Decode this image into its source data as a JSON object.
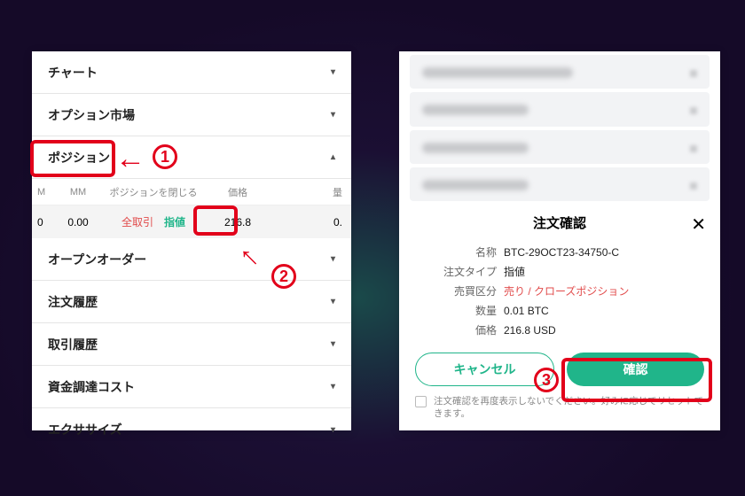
{
  "left": {
    "chart": "チャート",
    "options_market": "オプション市場",
    "position": "ポジション",
    "open_orders": "オープンオーダー",
    "order_history": "注文履歴",
    "trade_history": "取引履歴",
    "funding": "資金調達コスト",
    "exercise": "エクササイズ",
    "head": {
      "m": "M",
      "mm": "MM",
      "close_pos": "ポジションを閉じる",
      "price": "価格",
      "qty": "量"
    },
    "row": {
      "m": "0",
      "mm": "0.00",
      "all": "全取引",
      "limit": "指値",
      "price": "216.8",
      "qty": "0."
    }
  },
  "right": {
    "title": "注文確認",
    "labels": {
      "name": "名称",
      "otype": "注文タイプ",
      "side": "売買区分",
      "qty": "数量",
      "price": "価格"
    },
    "values": {
      "name": "BTC-29OCT23-34750-C",
      "otype": "指値",
      "side": "売り / クローズポジション",
      "qty": "0.01 BTC",
      "price": "216.8 USD"
    },
    "cancel": "キャンセル",
    "confirm": "確認",
    "foot": "注文確認を再度表示しないでください。好みに応じてリセットできます。"
  },
  "ann": {
    "n1": "1",
    "n2": "2",
    "n3": "3"
  }
}
